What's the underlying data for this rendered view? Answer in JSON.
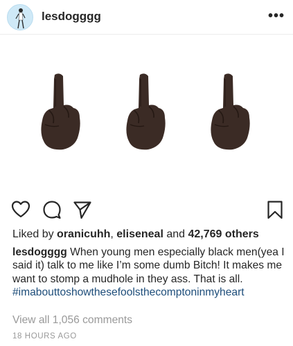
{
  "header": {
    "username": "lesdogggg",
    "more_label": "•••"
  },
  "post": {
    "emoji_icons": [
      "middle-finger-dark-skin-emoji",
      "middle-finger-dark-skin-emoji",
      "middle-finger-dark-skin-emoji"
    ],
    "emoji_color": "#3b2b25"
  },
  "actions": {
    "icons": [
      "heart-icon",
      "comment-icon",
      "share-icon",
      "bookmark-icon"
    ]
  },
  "likes": {
    "prefix": "Liked by ",
    "user1": "oranicuhh",
    "separator": ", ",
    "user2": "eliseneal",
    "middle": " and ",
    "count": "42,769 others"
  },
  "caption": {
    "username": "lesdogggg",
    "text": " When young men especially black men(yea I said it) talk to me like I’m some dumb Bitch! It makes me want to stomp a mudhole in they ass. That is all.",
    "hashtag": "#imabouttoshowthesefoolsthecomptoninmyheart"
  },
  "comments": {
    "view_all": "View all 1,056 comments"
  },
  "timestamp": "18 HOURS AGO",
  "colors": {
    "text": "#262626",
    "muted": "#999999",
    "hashtag": "#1d4d7a",
    "divider": "#ececec"
  }
}
